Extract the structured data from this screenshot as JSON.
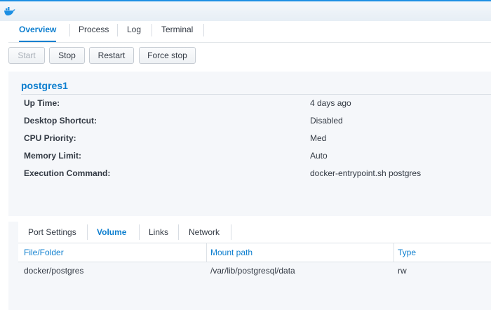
{
  "app": {
    "icon": "docker-whale-icon"
  },
  "tabs": [
    {
      "label": "Overview",
      "active": true
    },
    {
      "label": "Process",
      "active": false
    },
    {
      "label": "Log",
      "active": false
    },
    {
      "label": "Terminal",
      "active": false
    }
  ],
  "toolbar": {
    "start_label": "Start",
    "stop_label": "Stop",
    "restart_label": "Restart",
    "force_stop_label": "Force stop"
  },
  "container": {
    "name": "postgres1",
    "details": [
      {
        "label": "Up Time:",
        "value": "4 days ago"
      },
      {
        "label": "Desktop Shortcut:",
        "value": "Disabled"
      },
      {
        "label": "CPU Priority:",
        "value": "Med"
      },
      {
        "label": "Memory Limit:",
        "value": "Auto"
      },
      {
        "label": "Execution Command:",
        "value": "docker-entrypoint.sh postgres"
      }
    ]
  },
  "bottom_tabs": [
    {
      "label": "Port Settings",
      "active": false
    },
    {
      "label": "Volume",
      "active": true
    },
    {
      "label": "Links",
      "active": false
    },
    {
      "label": "Network",
      "active": false
    }
  ],
  "volume_table": {
    "columns": [
      "File/Folder",
      "Mount path",
      "Type"
    ],
    "rows": [
      [
        "docker/postgres",
        "/var/lib/postgresql/data",
        "rw"
      ]
    ]
  },
  "colors": {
    "accent": "#0e7fcf",
    "topbar_border": "#1d8fe3"
  }
}
